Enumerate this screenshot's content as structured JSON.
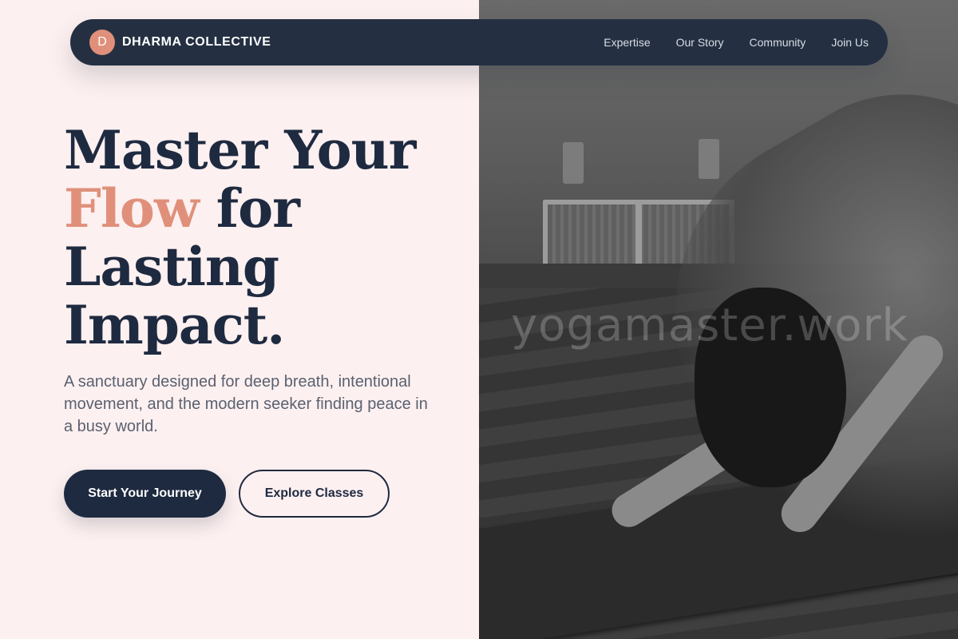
{
  "brand": {
    "logo_letter": "D",
    "name": "DHARMA COLLECTIVE",
    "accent_color": "#e0907a",
    "nav_color": "#243042"
  },
  "nav": {
    "links": [
      {
        "label": "Expertise"
      },
      {
        "label": "Our Story"
      },
      {
        "label": "Community"
      },
      {
        "label": "Join Us"
      }
    ]
  },
  "hero": {
    "headline_line1": "Master Your",
    "headline_accent": "Flow",
    "headline_line2_rest": " for",
    "headline_line3": "Lasting",
    "headline_line4": "Impact.",
    "subtext": "A sanctuary designed for deep breath, intentional movement, and the modern seeker finding peace in a busy world.",
    "primary_cta": "Start Your Journey",
    "secondary_cta": "Explore Classes"
  },
  "image": {
    "watermark": "yogamaster.work",
    "subject": "yoga-downward-dog-photo"
  }
}
